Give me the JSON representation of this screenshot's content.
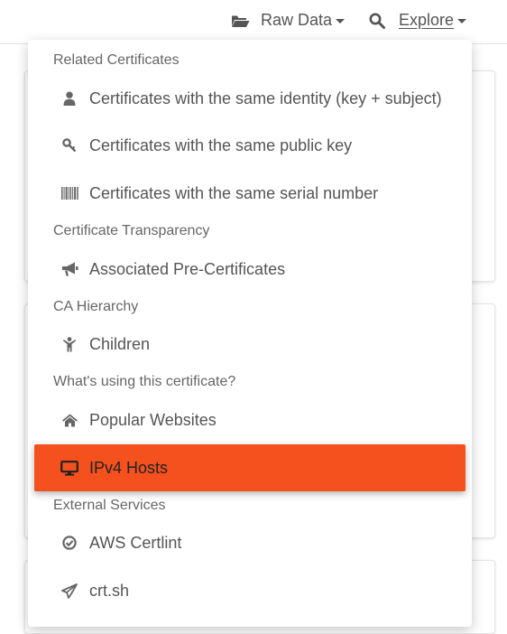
{
  "nav": {
    "raw_data": {
      "label": "Raw Data",
      "icon": "folder-open-icon"
    },
    "explore": {
      "label": "Explore",
      "icon": "search-icon"
    }
  },
  "menu": {
    "sections": [
      {
        "header": "Related Certificates",
        "items": [
          {
            "label": "Certificates with the same identity (key + subject)",
            "icon": "user-icon"
          },
          {
            "label": "Certificates with the same public key",
            "icon": "key-icon"
          },
          {
            "label": "Certificates with the same serial number",
            "icon": "barcode-icon"
          }
        ]
      },
      {
        "header": "Certificate Transparency",
        "items": [
          {
            "label": "Associated Pre-Certificates",
            "icon": "bullhorn-icon"
          }
        ]
      },
      {
        "header": "CA Hierarchy",
        "items": [
          {
            "label": "Children",
            "icon": "child-icon"
          }
        ]
      },
      {
        "header": "What's using this certificate?",
        "items": [
          {
            "label": "Popular Websites",
            "icon": "home-icon"
          },
          {
            "label": "IPv4 Hosts",
            "icon": "desktop-icon",
            "active": true
          }
        ]
      },
      {
        "header": "External Services",
        "items": [
          {
            "label": "AWS Certlint",
            "icon": "check-circle-icon"
          },
          {
            "label": "crt.sh",
            "icon": "paper-plane-icon"
          }
        ]
      }
    ]
  },
  "colors": {
    "active_bg": "#f4511e",
    "text": "#555555",
    "header_text": "#666666"
  }
}
